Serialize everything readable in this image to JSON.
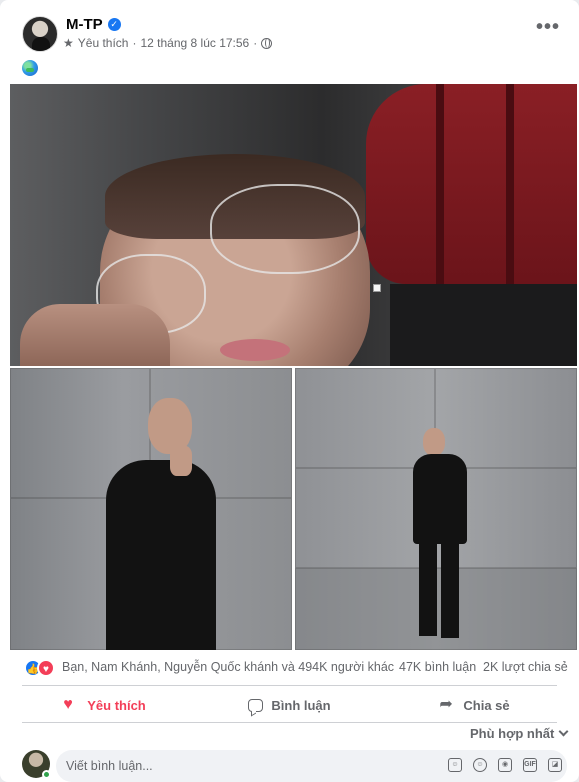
{
  "post": {
    "author": "M-TP",
    "relationship": "Yêu thích",
    "separator": "·",
    "timestamp": "12 tháng 8 lúc 17:56",
    "separator2": "·",
    "more_label": "•••"
  },
  "stats": {
    "reaction_summary": "Bạn, Nam Khánh, Nguyễn Quốc khánh và 494K người khác",
    "comments": "47K bình luận",
    "shares": "2K lượt chia sẻ"
  },
  "actions": {
    "like_label": "Yêu thích",
    "comment_label": "Bình luận",
    "share_label": "Chia sẻ"
  },
  "comments": {
    "sort_label": "Phù hợp nhất",
    "input_placeholder": "Viết bình luận..."
  },
  "colors": {
    "accent": "#1877f2",
    "love": "#f33e58",
    "muted": "#65676b",
    "online": "#31a24c"
  },
  "icons": {
    "verified": "verified-badge-icon",
    "audience": "globe-icon",
    "relationship": "star-icon",
    "like": "heart-icon",
    "comment": "comment-icon",
    "share": "share-icon"
  }
}
